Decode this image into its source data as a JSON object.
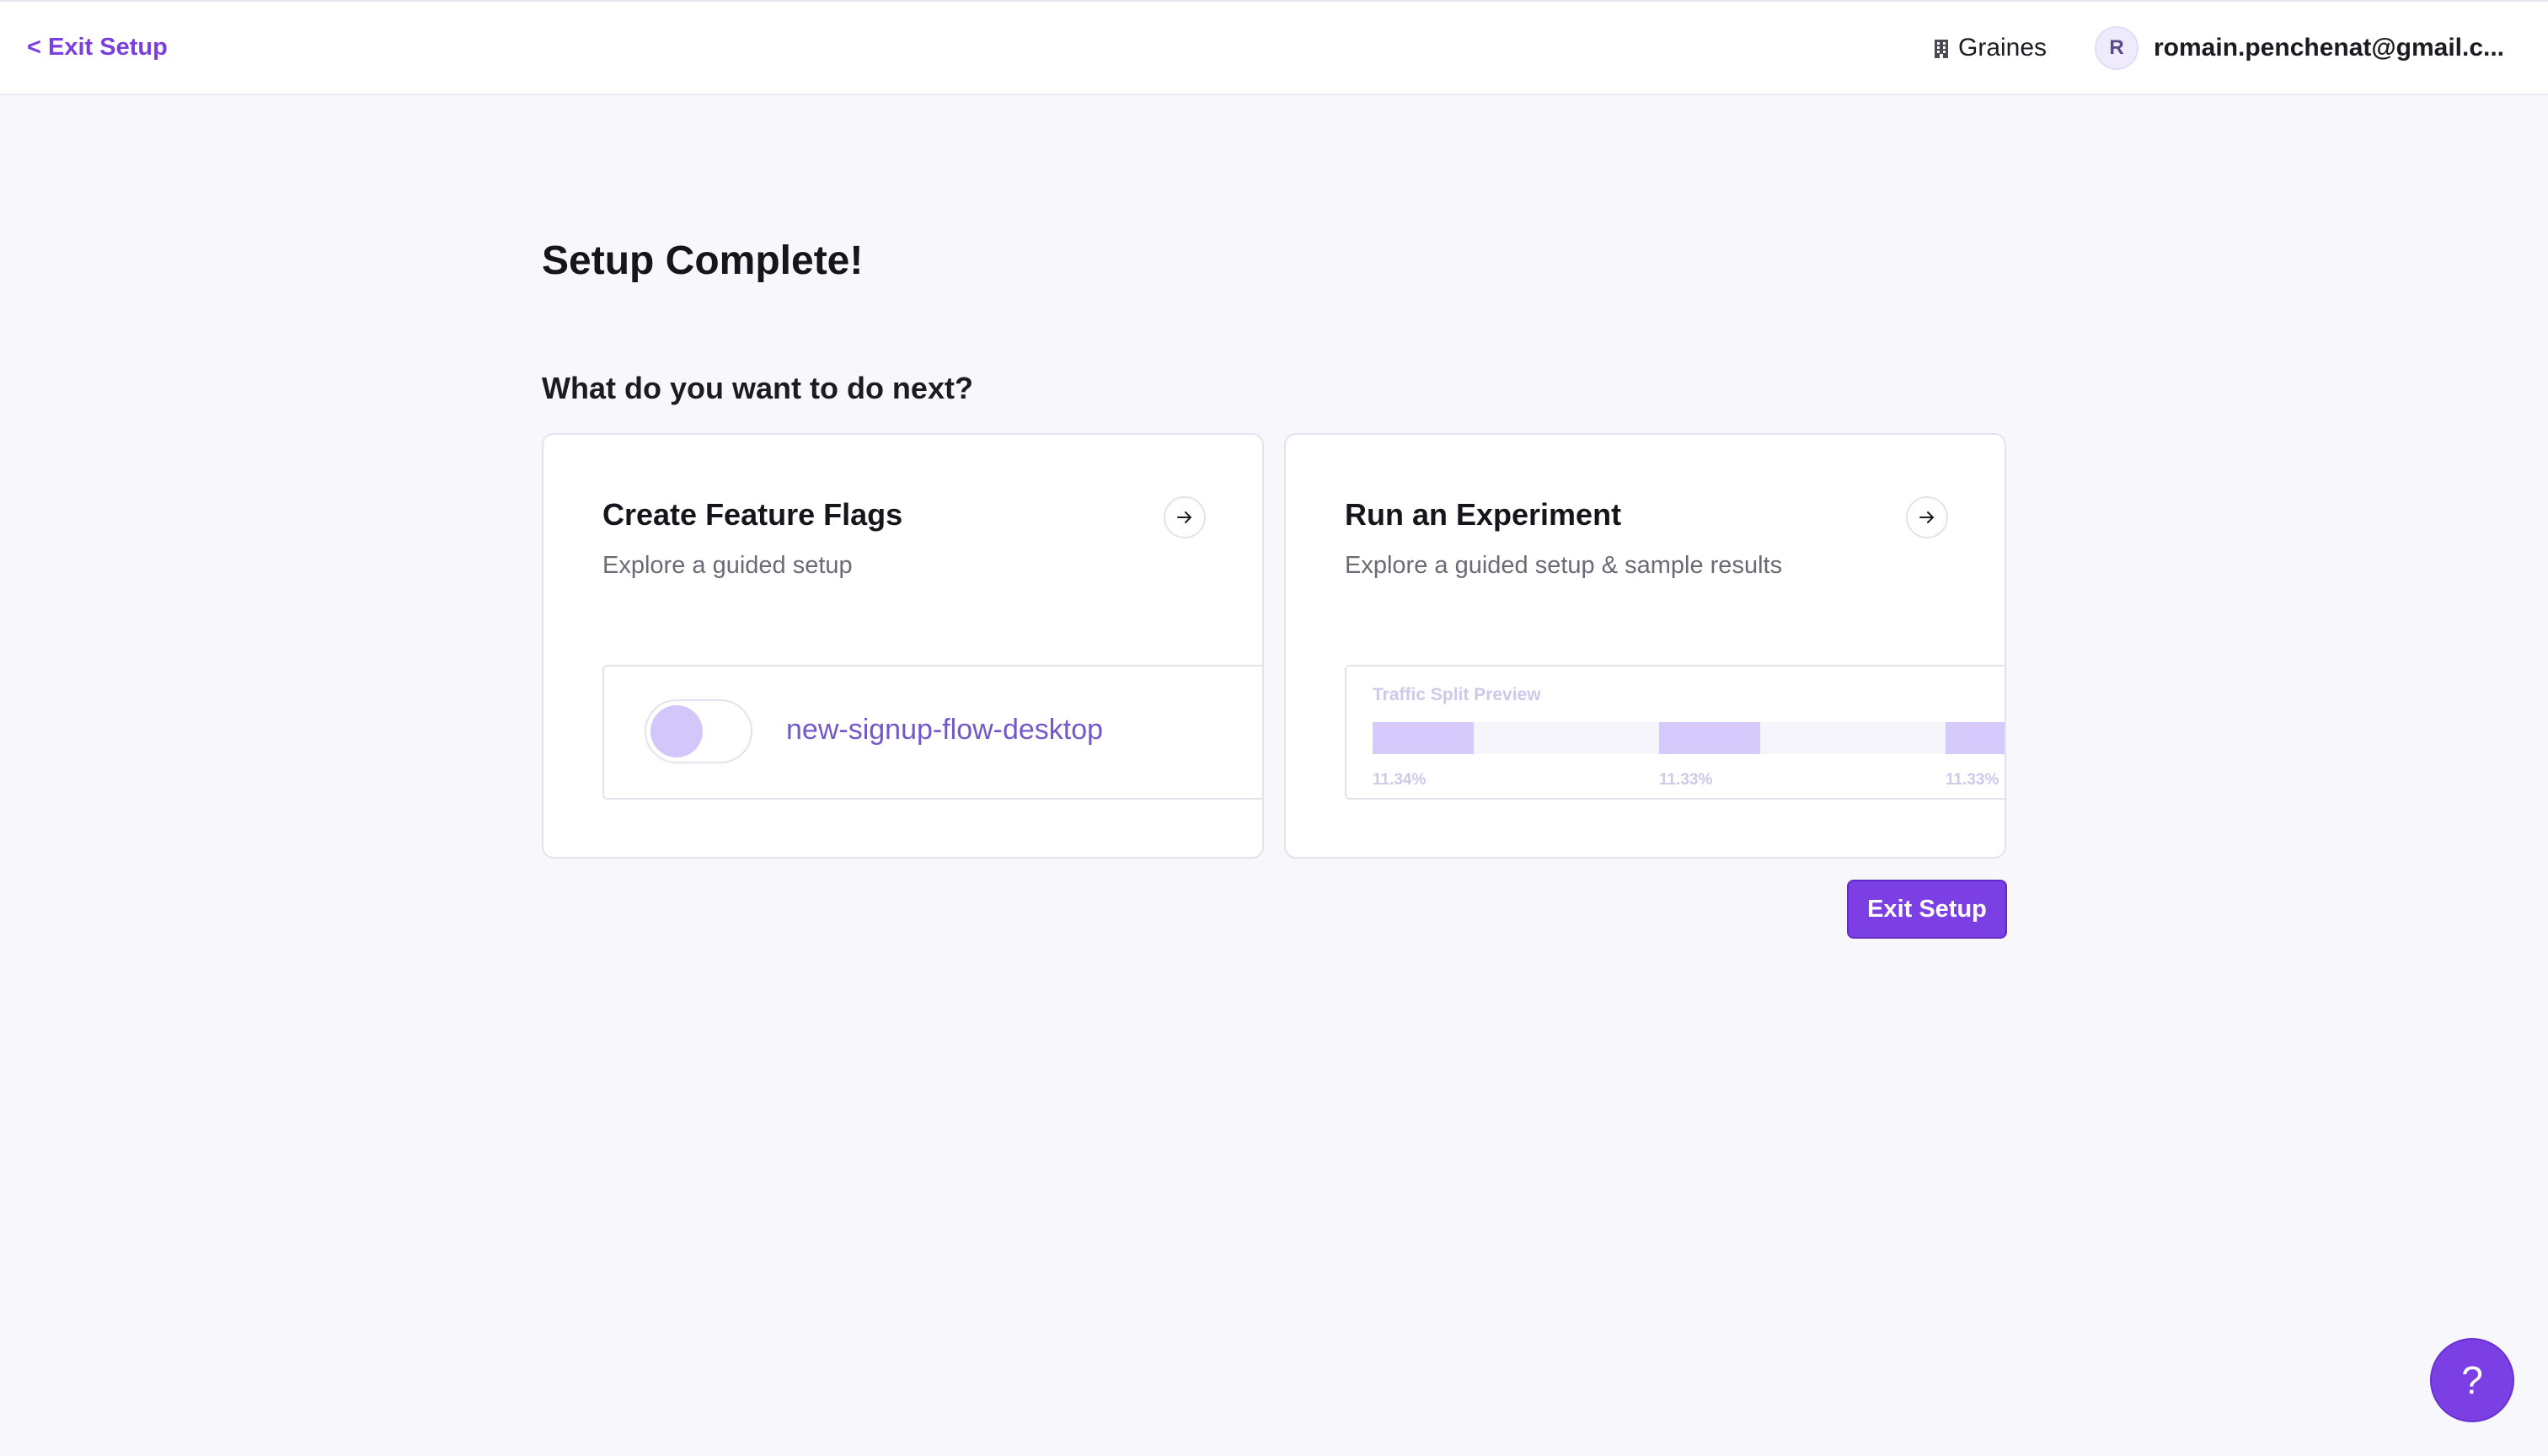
{
  "header": {
    "back_label": "< Exit Setup",
    "org_name": "Graines",
    "org_icon": "building-icon",
    "user_initial": "R",
    "user_email": "romain.penchenat@gmail.c..."
  },
  "main": {
    "title": "Setup Complete!",
    "subtitle": "What do you want to do next?",
    "cards": [
      {
        "title": "Create Feature Flags",
        "description": "Explore a guided setup",
        "icon": "arrow-right-icon",
        "preview": {
          "flag_name": "new-signup-flow-desktop",
          "toggle_on": false
        }
      },
      {
        "title": "Run an Experiment",
        "description": "Explore a guided setup & sample results",
        "icon": "arrow-right-icon",
        "preview": {
          "label": "Traffic Split Preview",
          "splits": [
            {
              "percent_label": "11.34%",
              "value": 11.34
            },
            {
              "percent_label": "11.33%",
              "value": 11.33
            },
            {
              "percent_label": "11.33%",
              "value": 11.33
            }
          ]
        }
      }
    ],
    "exit_button": "Exit Setup"
  },
  "help_button": "?",
  "colors": {
    "accent": "#7b3fe4",
    "link": "#7a3fe0",
    "flag_text": "#7358cc",
    "bar_fill": "#d6cafc",
    "background": "#f8f7fc"
  }
}
